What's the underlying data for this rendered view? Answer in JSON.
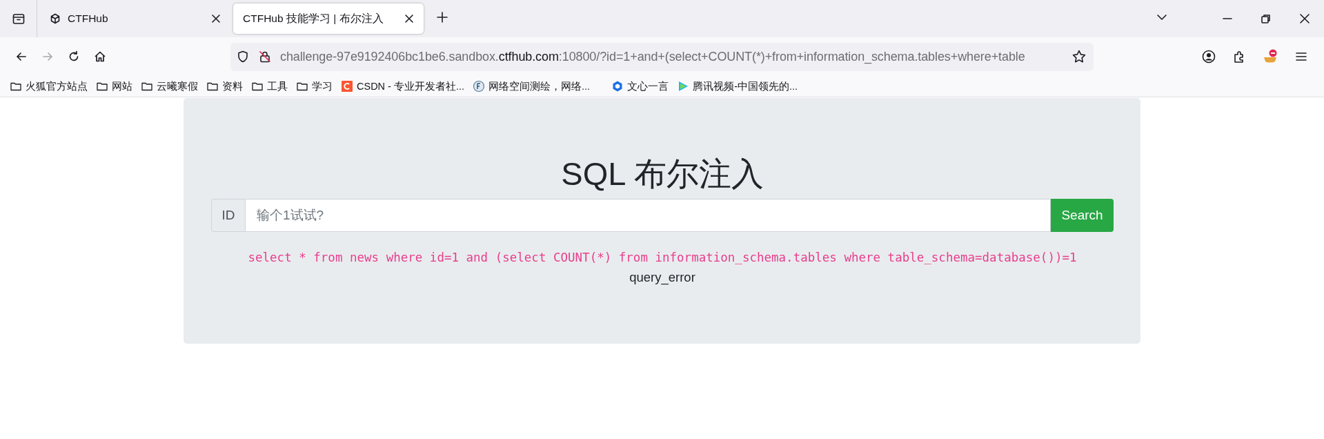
{
  "tabs": [
    {
      "title": "CTFHub",
      "selected": false
    },
    {
      "title": "CTFHub 技能学习 | 布尔注入",
      "selected": true
    }
  ],
  "nav_buttons": [
    {
      "kind": "back",
      "disabled": false
    },
    {
      "kind": "forward",
      "disabled": true
    },
    {
      "kind": "reload",
      "disabled": false
    },
    {
      "kind": "home",
      "disabled": false
    }
  ],
  "address_bar": {
    "prefix": "challenge-97e9192406bc1be6.sandbox.",
    "domain": "ctfhub.com",
    "suffix": ":10800/?id=1+and+(select+COUNT(*)+from+information_schema.tables+where+table"
  },
  "bookmarks": [
    {
      "kind": "folder",
      "label": "火狐官方站点"
    },
    {
      "kind": "folder",
      "label": "网站"
    },
    {
      "kind": "folder",
      "label": "云曦寒假"
    },
    {
      "kind": "folder",
      "label": "资料"
    },
    {
      "kind": "folder",
      "label": "工具"
    },
    {
      "kind": "folder",
      "label": "学习"
    },
    {
      "kind": "csdn",
      "label": "CSDN - 专业开发者社..."
    },
    {
      "kind": "globe",
      "label": "网络空间测绘，网络..."
    },
    {
      "kind": "cube",
      "label": "文心一言"
    },
    {
      "kind": "play",
      "label": "腾讯视频-中国领先的..."
    }
  ],
  "page": {
    "title": "SQL 布尔注入",
    "input_addon": "ID",
    "input_placeholder": "输个1试试?",
    "button": "Search",
    "query": "select * from news where id=1 and (select COUNT(*) from information_schema.tables where table_schema=database())=1",
    "result": "query_error"
  }
}
